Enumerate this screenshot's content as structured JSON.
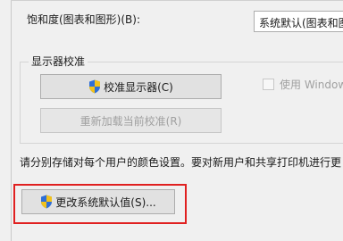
{
  "saturation": {
    "label": "饱和度(图表和图形)(B):",
    "combo_value": "系统默认(图表和图形)"
  },
  "calibration_group": {
    "title": "显示器校准",
    "calibrate_button": "校准显示器(C)",
    "reload_button": "重新加载当前校准(R)",
    "windows_checkbox_label": "使用 Windows"
  },
  "description": "请分别存储对每个用户的颜色设置。要对新用户和共享打印机进行更",
  "change_defaults_button": "更改系统默认值(S)...",
  "icons": {
    "shield": "uac-shield-icon"
  },
  "colors": {
    "highlight": "#e02020",
    "shield_blue": "#2f6fd6",
    "shield_yellow": "#f2c21b"
  }
}
